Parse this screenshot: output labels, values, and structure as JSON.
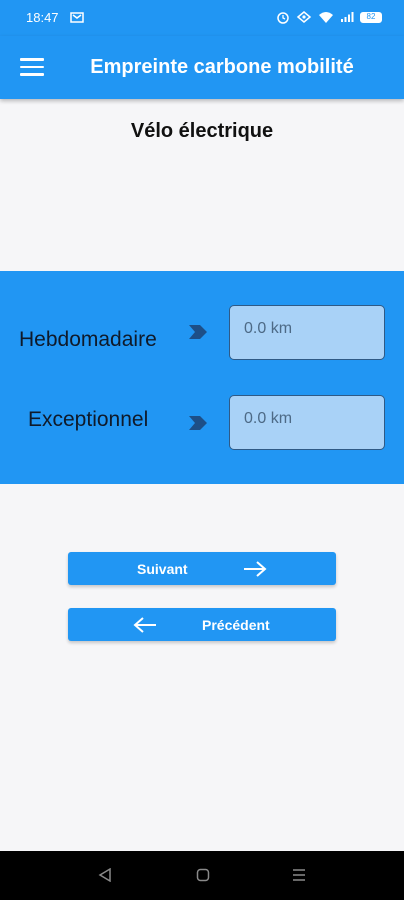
{
  "status_bar": {
    "time": "18:47",
    "battery": "82",
    "icons": [
      "cast-icon",
      "alarm-icon",
      "data-icon",
      "wifi-icon",
      "signal-icon",
      "battery-icon"
    ]
  },
  "app_bar": {
    "title": "Empreinte carbone mobilité",
    "menu_icon": "hamburger-menu-icon"
  },
  "page": {
    "title": "Vélo électrique"
  },
  "form": {
    "weekly_label": "Hebdomadaire",
    "weekly_value": "0.0 km",
    "exceptional_label": "Exceptionnel",
    "exceptional_value": "0.0 km"
  },
  "buttons": {
    "next_label": "Suivant",
    "previous_label": "Précédent"
  },
  "colors": {
    "primary": "#2196f3",
    "field_background": "#a9d2f7",
    "label_text": "#0f1a2a"
  }
}
